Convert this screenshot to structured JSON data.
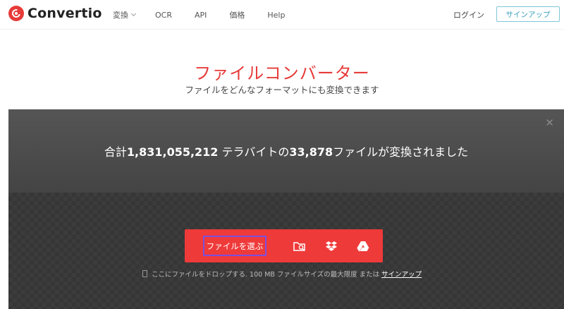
{
  "brand": {
    "name": "Convertio"
  },
  "nav": {
    "items": [
      {
        "label": "変換",
        "has_dropdown": true
      },
      {
        "label": "OCR"
      },
      {
        "label": "API"
      },
      {
        "label": "価格"
      },
      {
        "label": "Help"
      }
    ],
    "login_label": "ログイン",
    "signup_label": "サインアップ"
  },
  "hero": {
    "title": "ファイルコンバーター",
    "subtitle": "ファイルをどんなフォーマットにも変換できます"
  },
  "converter": {
    "stats": {
      "prefix": "合計",
      "terabytes": "1,831,055,212",
      "middle": " テラバイトの",
      "files": "33,878",
      "suffix": "ファイルが変換されました"
    },
    "close_icon": "close-icon",
    "choose_label": "ファイルを選ぶ",
    "sources": [
      "folder-search-icon",
      "dropbox-icon",
      "google-drive-icon"
    ],
    "drop_hint": "ここにファイルをドロップする. 100 MB ファイルサイズの最大限度 または",
    "drop_link": "サインアップ"
  },
  "colors": {
    "accent": "#e63b39",
    "button_red": "#ef3a3a",
    "focus_outline": "#7b4fe0",
    "signup_border": "#7fc6d9"
  }
}
